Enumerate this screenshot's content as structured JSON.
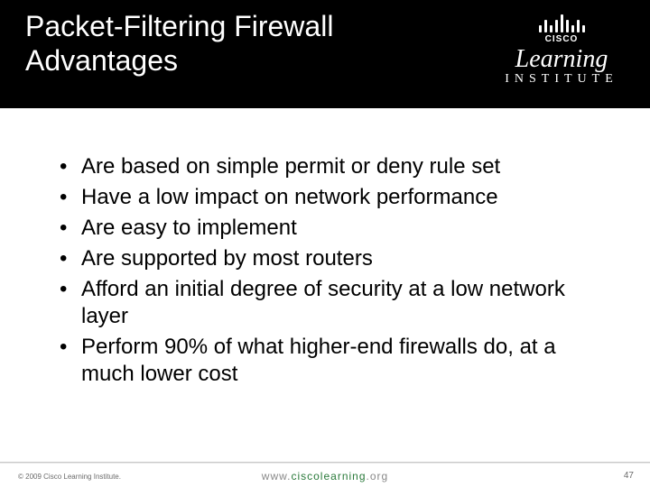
{
  "header": {
    "title_line1": "Packet-Filtering Firewall",
    "title_line2": "Advantages"
  },
  "logo": {
    "brand": "CISCO",
    "word1": "Learning",
    "word2": "INSTITUTE"
  },
  "bullets": [
    "Are based on simple permit or deny rule set",
    "Have a low impact on network performance",
    "Are easy to implement",
    "Are supported by most routers",
    "Afford an initial degree of security at a low network layer",
    "Perform 90% of what higher-end firewalls do, at a much lower cost"
  ],
  "footer": {
    "copyright": "© 2009 Cisco Learning Institute.",
    "url_prefix": "www.",
    "url_mid": "ciscolearning",
    "url_suffix": ".org",
    "slide_number": "47"
  }
}
